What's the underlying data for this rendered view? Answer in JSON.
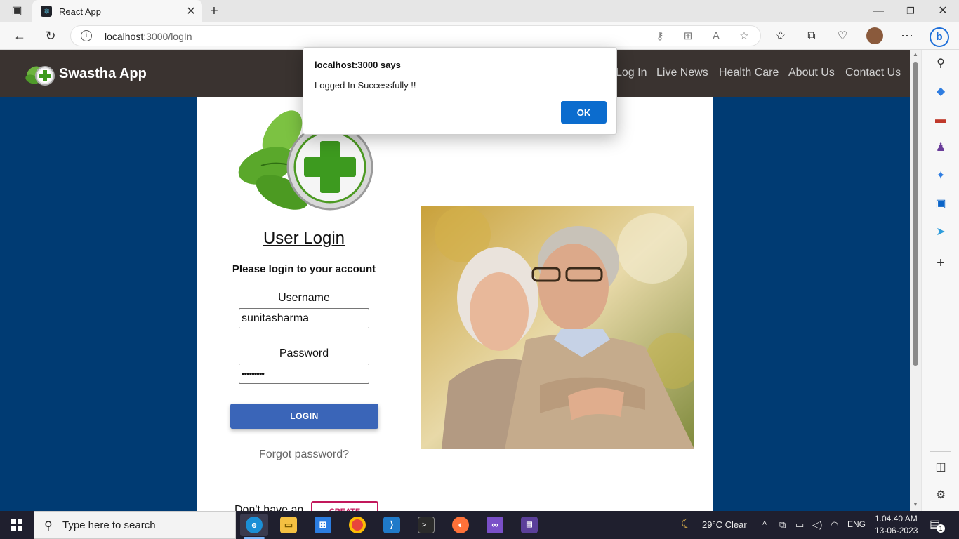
{
  "browser": {
    "tab_title": "React App",
    "url_host": "localhost",
    "url_rest": ":3000/logIn"
  },
  "app": {
    "brand": "Swastha App",
    "nav": [
      "Log In",
      "Live News",
      "Health Care",
      "About Us",
      "Contact Us"
    ]
  },
  "login": {
    "title": "User Login",
    "subtitle": "Please login to your account",
    "username_label": "Username",
    "username_value": "sunitasharma",
    "password_label": "Password",
    "password_value": "•••••••••",
    "login_button": "LOGIN",
    "forgot": "Forgot password?",
    "no_account": "Don't have an",
    "create_button": "CREATE"
  },
  "dialog": {
    "title": "localhost:3000 says",
    "message": "Logged In Successfully !!",
    "ok": "OK"
  },
  "taskbar": {
    "search_placeholder": "Type here to search",
    "weather": "29°C  Clear",
    "language": "ENG",
    "time": "1.04.40 AM",
    "date": "13-06-2023",
    "notification_count": "1"
  },
  "colors": {
    "page_bg": "#003b73",
    "nav_bg": "#3a3330",
    "login_button": "#3a65b8",
    "create_border": "#c2185b",
    "dialog_ok": "#0b6cce"
  }
}
